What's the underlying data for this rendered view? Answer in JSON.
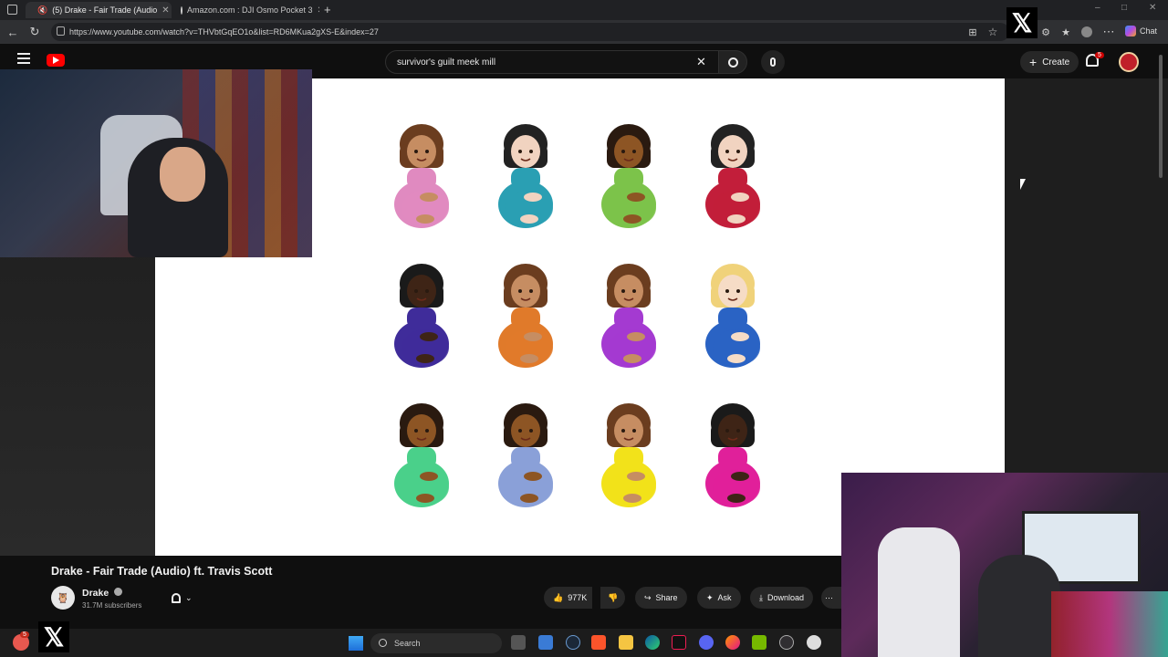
{
  "browser": {
    "tabs": [
      {
        "label": "(5) Drake - Fair Trade (Audio"
      },
      {
        "label": "Amazon.com : DJI Osmo Pocket 3"
      }
    ],
    "url": "https://www.youtube.com/watch?v=THVbtGqEO1o&list=RD6MKua2gXS-E&index=27",
    "chat_label": "Chat"
  },
  "youtube": {
    "search_value": "survivor's guilt meek mill",
    "create_label": "Create",
    "notif_count": "5"
  },
  "video": {
    "title": "Drake - Fair Trade (Audio) ft. Travis Scott",
    "channel": "Drake",
    "subscribers": "31.7M subscribers",
    "likes": "977K",
    "share_label": "Share",
    "ask_label": "Ask",
    "download_label": "Download"
  },
  "emoji_grid": [
    {
      "skin": "#c68d62",
      "hair": "#6b3d1f",
      "shirt": "#e08ac0"
    },
    {
      "skin": "#f1d3c0",
      "hair": "#222222",
      "shirt": "#2a9fb3"
    },
    {
      "skin": "#8d5524",
      "hair": "#2a1a10",
      "shirt": "#7cc34a"
    },
    {
      "skin": "#f1d3c0",
      "hair": "#222222",
      "shirt": "#c21e3a"
    },
    {
      "skin": "#3e2416",
      "hair": "#1a1a1a",
      "shirt": "#3f2c9a"
    },
    {
      "skin": "#c68d62",
      "hair": "#6b3d1f",
      "shirt": "#e07a2a"
    },
    {
      "skin": "#c68d62",
      "hair": "#6b3d1f",
      "shirt": "#a43ad1"
    },
    {
      "skin": "#f6dcc6",
      "hair": "#f0d27a",
      "shirt": "#2a63c4"
    },
    {
      "skin": "#8d5524",
      "hair": "#2a1a10",
      "shirt": "#4ad08a"
    },
    {
      "skin": "#8d5524",
      "hair": "#2a1a10",
      "shirt": "#8aa0d8"
    },
    {
      "skin": "#c68d62",
      "hair": "#6b3d1f",
      "shirt": "#f2e21a"
    },
    {
      "skin": "#3e2416",
      "hair": "#1a1a1a",
      "shirt": "#e0209a"
    }
  ],
  "taskbar": {
    "search_placeholder": "Search",
    "badge": "5"
  }
}
